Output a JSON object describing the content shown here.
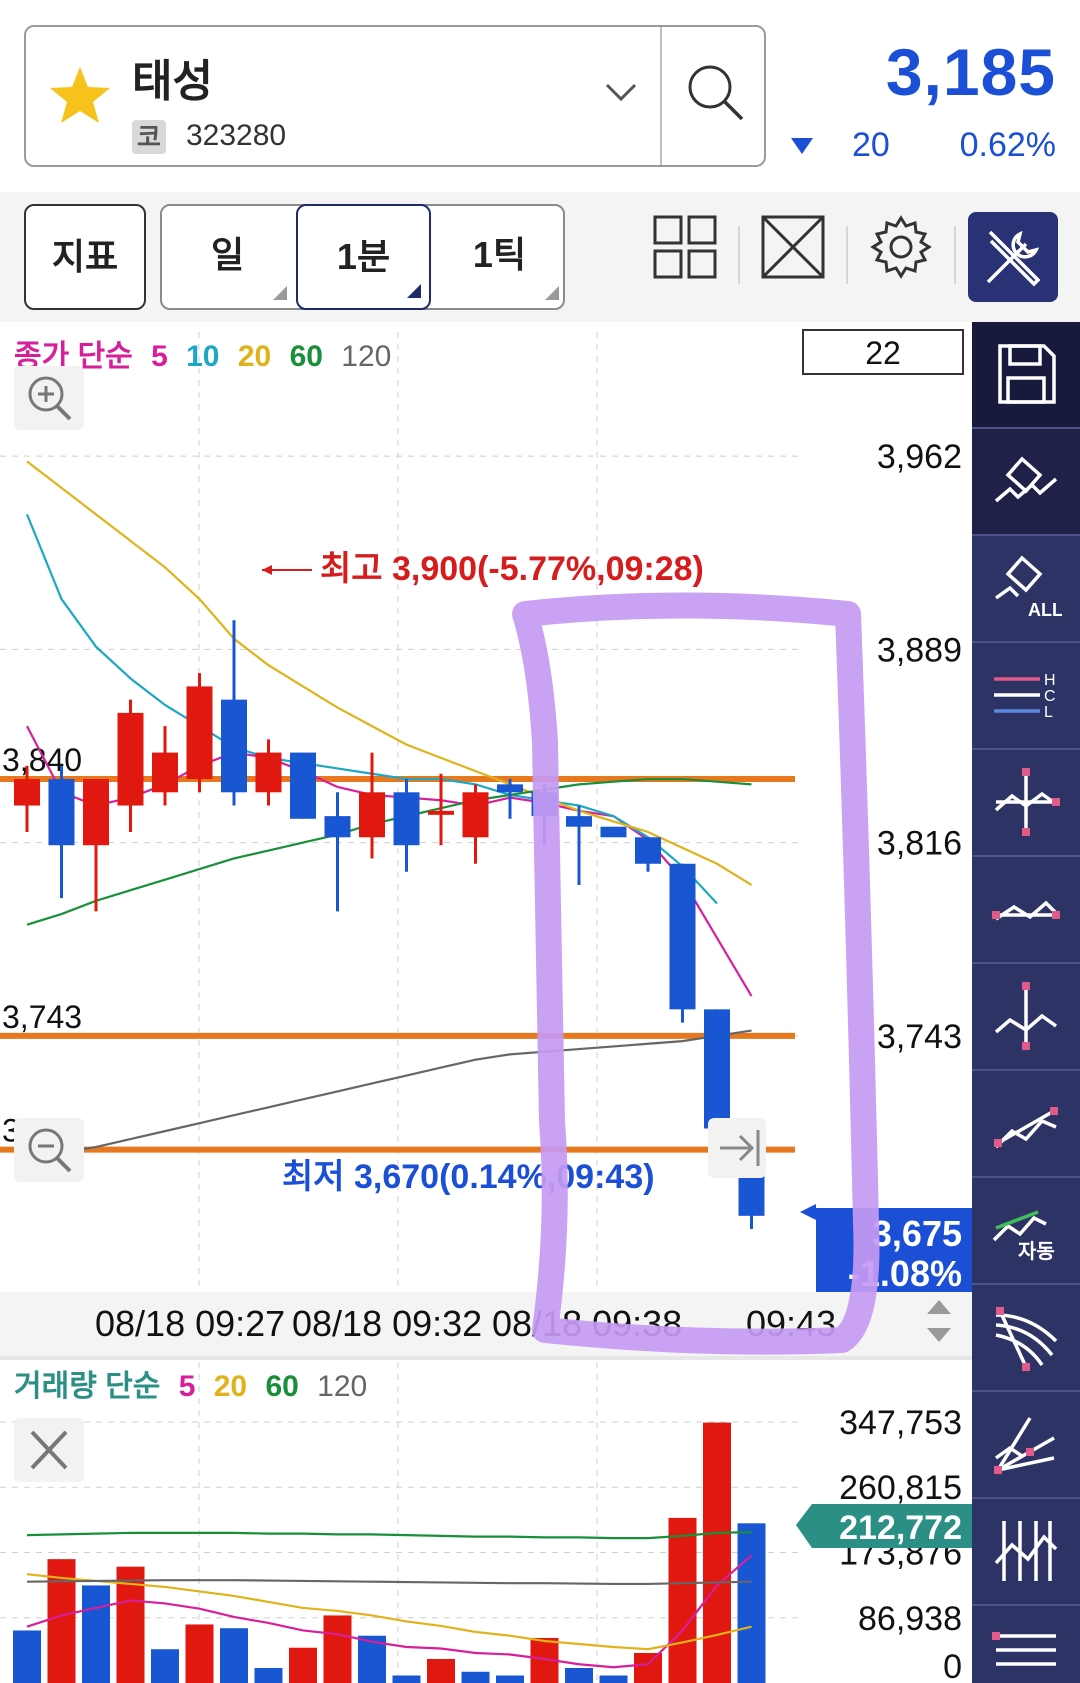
{
  "header": {
    "stock_name": "태성",
    "market_badge": "코",
    "stock_code": "323280",
    "price": "3,185",
    "change": "20",
    "change_rate": "0.62%"
  },
  "toolbar": {
    "indicator_label": "지표",
    "period_day": "일",
    "period_1min": "1분",
    "period_1tick": "1틱"
  },
  "side_tools": [
    "save-icon",
    "eraser-icon",
    "eraser-all-icon",
    "hcl-line-icon",
    "crosshair-icon",
    "trend-icon",
    "vertical-line-icon",
    "trendline-icon",
    "auto-trend-icon",
    "fan-icon",
    "speed-line-icon",
    "vertical-lines-icon",
    "horizontal-lines-icon"
  ],
  "side_tools_labels": {
    "eraser_all": "ALL",
    "hcl_h": "H",
    "hcl_c": "C",
    "hcl_l": "L",
    "auto": "자동"
  },
  "price_chart": {
    "legend_prefix": "종가 단순",
    "legend_periods": [
      "5",
      "10",
      "20",
      "60",
      "120"
    ],
    "candle_count_box": "22",
    "y_ticks": [
      "3,962",
      "3,889",
      "3,816",
      "3,743"
    ],
    "ylim": [
      3650,
      3990
    ],
    "x_ticks": [
      "08/18 09:27",
      "08/18 09:32",
      "08/18 09:38",
      "09:43"
    ],
    "high_annotation": "최고 3,900(-5.77%,09:28)",
    "low_annotation": "최저 3,670(0.14%,09:43)",
    "current_price": "3,675",
    "current_rate": "-1.08%",
    "horizontal_lines": [
      {
        "label": "3,840",
        "value": 3840
      },
      {
        "label": "3,743",
        "value": 3743
      },
      {
        "label": "3,700",
        "value": 3700
      }
    ],
    "candles": [
      {
        "o": 3830,
        "h": 3845,
        "l": 3820,
        "c": 3840
      },
      {
        "o": 3840,
        "h": 3845,
        "l": 3795,
        "c": 3815
      },
      {
        "o": 3815,
        "h": 3840,
        "l": 3790,
        "c": 3840
      },
      {
        "o": 3830,
        "h": 3870,
        "l": 3820,
        "c": 3865
      },
      {
        "o": 3835,
        "h": 3860,
        "l": 3830,
        "c": 3850
      },
      {
        "o": 3840,
        "h": 3880,
        "l": 3835,
        "c": 3875
      },
      {
        "o": 3870,
        "h": 3900,
        "l": 3830,
        "c": 3835
      },
      {
        "o": 3835,
        "h": 3855,
        "l": 3830,
        "c": 3850
      },
      {
        "o": 3850,
        "h": 3850,
        "l": 3825,
        "c": 3825
      },
      {
        "o": 3826,
        "h": 3835,
        "l": 3790,
        "c": 3818
      },
      {
        "o": 3818,
        "h": 3850,
        "l": 3810,
        "c": 3835
      },
      {
        "o": 3835,
        "h": 3840,
        "l": 3805,
        "c": 3815
      },
      {
        "o": 3828,
        "h": 3842,
        "l": 3815,
        "c": 3828
      },
      {
        "o": 3818,
        "h": 3838,
        "l": 3808,
        "c": 3835
      },
      {
        "o": 3838,
        "h": 3840,
        "l": 3825,
        "c": 3835
      },
      {
        "o": 3835,
        "h": 3838,
        "l": 3815,
        "c": 3826
      },
      {
        "o": 3826,
        "h": 3830,
        "l": 3800,
        "c": 3822
      },
      {
        "o": 3822,
        "h": 3822,
        "l": 3822,
        "c": 3818
      },
      {
        "o": 3818,
        "h": 3818,
        "l": 3805,
        "c": 3808
      },
      {
        "o": 3808,
        "h": 3808,
        "l": 3748,
        "c": 3753
      },
      {
        "o": 3753,
        "h": 3753,
        "l": 3690,
        "c": 3708
      },
      {
        "o": 3700,
        "h": 3705,
        "l": 3670,
        "c": 3675
      }
    ],
    "ma_lines": [
      {
        "period": "5",
        "color": "#d71f9b",
        "values": [
          3860,
          3835,
          3830,
          3833,
          3838,
          3845,
          3850,
          3848,
          3843,
          3837,
          3834,
          3833,
          3832,
          3830,
          3833,
          3831,
          3828,
          3826,
          3817,
          3802,
          3780,
          3758
        ]
      },
      {
        "period": "10",
        "color": "#1ba8c4",
        "values": [
          3940,
          3908,
          3890,
          3878,
          3868,
          3860,
          3852,
          3848,
          3846,
          3844,
          3842,
          3840,
          3840,
          3838,
          3834,
          3832,
          3830,
          3826,
          3818,
          3807,
          3793,
          null
        ]
      },
      {
        "period": "20",
        "color": "#e0b21b",
        "values": [
          3960,
          3950,
          3940,
          3930,
          3920,
          3908,
          3893,
          3883,
          3875,
          3867,
          3860,
          3853,
          3848,
          3843,
          3838,
          3833,
          3828,
          3824,
          3820,
          3814,
          3808,
          3800
        ]
      },
      {
        "period": "60",
        "color": "#1a8f3a",
        "values": [
          3785,
          3789,
          3794,
          3798,
          3802,
          3806,
          3810,
          3813,
          3816,
          3819,
          3823,
          3826,
          3829,
          3832,
          3834,
          3836,
          3838,
          3839,
          3840,
          3840,
          3839,
          3838
        ]
      },
      {
        "period": "120",
        "color": "#666666",
        "values": [
          3696,
          3699,
          3701,
          3704,
          3707,
          3710,
          3713,
          3716,
          3719,
          3722,
          3725,
          3728,
          3731,
          3734,
          3736,
          3737,
          3738,
          3739,
          3740,
          3741,
          3743,
          3745
        ]
      }
    ]
  },
  "volume_chart": {
    "legend_prefix": "거래량 단순",
    "legend_periods": [
      "5",
      "20",
      "60",
      "120"
    ],
    "y_ticks": [
      "347,753",
      "260,815",
      "173,876",
      "86,938",
      "0"
    ],
    "ylim": [
      0,
      347753
    ],
    "current_volume": "212,772",
    "bars": [
      {
        "v": 70000,
        "up": false
      },
      {
        "v": 165000,
        "up": true
      },
      {
        "v": 130000,
        "up": false
      },
      {
        "v": 155000,
        "up": true
      },
      {
        "v": 45000,
        "up": false
      },
      {
        "v": 78000,
        "up": true
      },
      {
        "v": 73000,
        "up": false
      },
      {
        "v": 20000,
        "up": false
      },
      {
        "v": 47000,
        "up": true
      },
      {
        "v": 90000,
        "up": true
      },
      {
        "v": 63000,
        "up": false
      },
      {
        "v": 10000,
        "up": false
      },
      {
        "v": 32000,
        "up": true
      },
      {
        "v": 15000,
        "up": false
      },
      {
        "v": 10000,
        "up": false
      },
      {
        "v": 60000,
        "up": true
      },
      {
        "v": 20000,
        "up": false
      },
      {
        "v": 10000,
        "up": false
      },
      {
        "v": 40000,
        "up": true
      },
      {
        "v": 220000,
        "up": true
      },
      {
        "v": 347000,
        "up": true
      },
      {
        "v": 212772,
        "up": false
      }
    ],
    "ma_lines": [
      {
        "period": "5",
        "color": "#d71f9b",
        "values": [
          75000,
          90000,
          100000,
          110000,
          106000,
          99000,
          88000,
          80000,
          70000,
          65000,
          55000,
          48000,
          46000,
          40000,
          38000,
          32000,
          25000,
          21000,
          25000,
          70000,
          130000,
          170000
        ]
      },
      {
        "period": "20",
        "color": "#e0b21b",
        "values": [
          145000,
          140000,
          136000,
          132000,
          128000,
          122000,
          116000,
          108000,
          100000,
          96000,
          90000,
          82000,
          76000,
          68000,
          63000,
          56000,
          52000,
          48000,
          45000,
          54000,
          64000,
          75000
        ]
      },
      {
        "period": "60",
        "color": "#1a8f3a",
        "values": [
          197000,
          198000,
          199000,
          200000,
          200000,
          200000,
          200000,
          199000,
          199000,
          198000,
          198000,
          197000,
          196000,
          195000,
          195000,
          194000,
          194000,
          193000,
          193000,
          196000,
          200000,
          201000
        ]
      },
      {
        "period": "120",
        "color": "#666666",
        "values": [
          135000,
          135500,
          136000,
          136500,
          137000,
          137000,
          137000,
          136500,
          136000,
          135500,
          135000,
          134500,
          134000,
          133500,
          133000,
          133000,
          132500,
          132000,
          132000,
          133000,
          134000,
          135000
        ]
      }
    ]
  },
  "colors": {
    "up": "#e0180f",
    "down": "#1956d2",
    "price_blue": "#1b4fd6",
    "hline": "#e8781e",
    "highlight": "#c59af3",
    "panel": "#2e3366",
    "volume_badge": "#2c8f86"
  }
}
